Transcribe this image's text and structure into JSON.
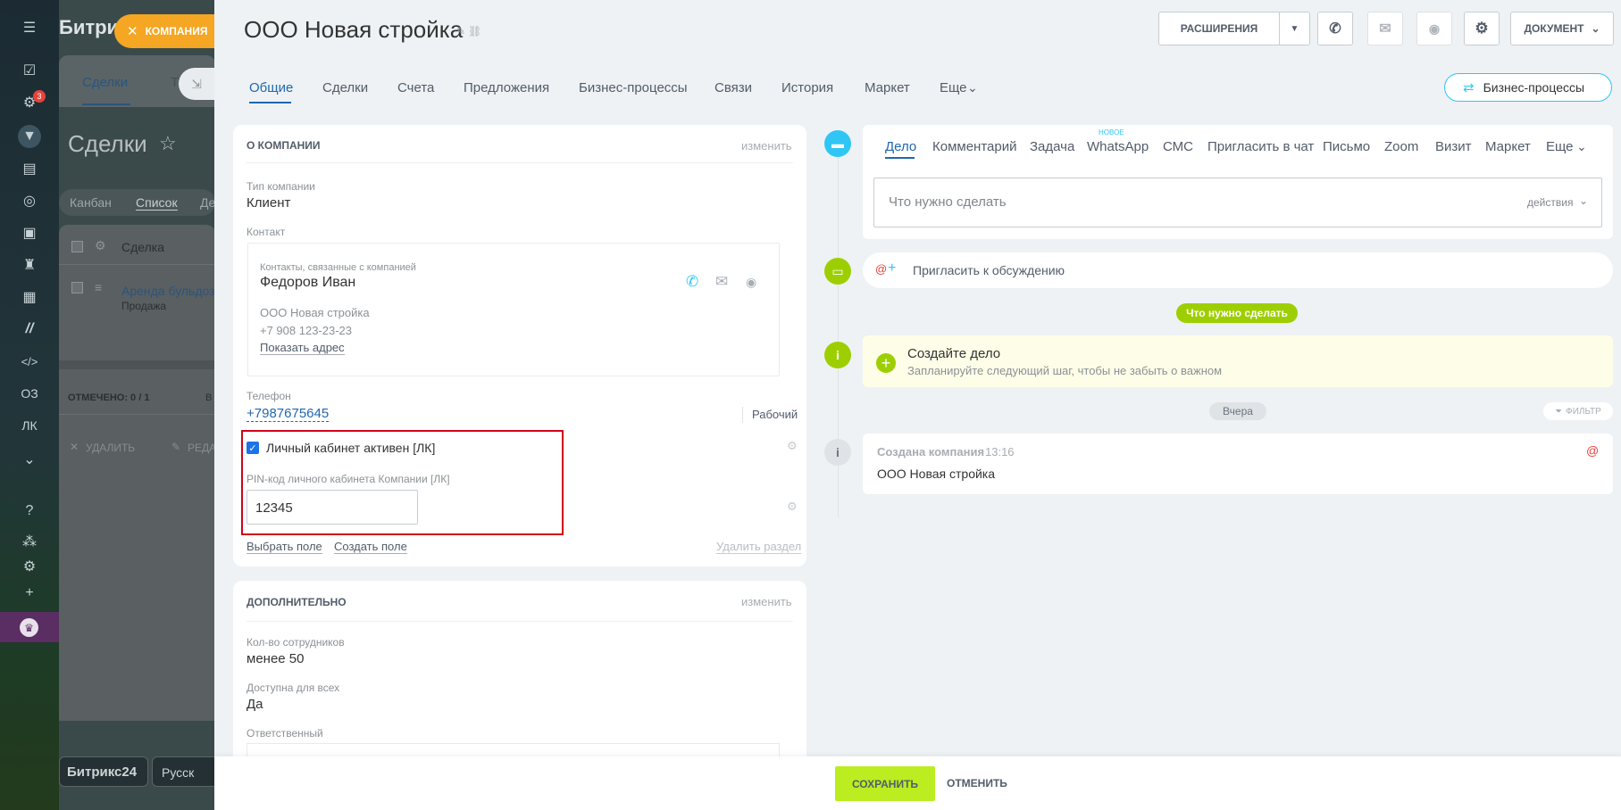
{
  "sidebar": {
    "badge_count": "3",
    "item_oz": "ОЗ",
    "item_lk": "ЛК"
  },
  "background": {
    "brand": "Битри",
    "company_chip": "КОМПАНИЯ",
    "tab_deals": "Сделки",
    "tab_t": "Т",
    "page_title": "Сделки",
    "view_kanban": "Канбан",
    "view_list": "Список",
    "view_de": "Де",
    "col_deal": "Сделка",
    "row_title": "Аренда бульдоз",
    "row_subtitle": "Продажа",
    "marked": "ОТМЕЧЕНО: 0 / 1",
    "marked_extra": "В",
    "delete": "УДАЛИТЬ",
    "edit": "РЕДА",
    "footer_brand": "Битрикс24",
    "footer_lang": "Русск"
  },
  "header": {
    "title": "ООО Новая стройка",
    "extensions": "РАСШИРЕНИЯ",
    "document": "ДОКУМЕНТ"
  },
  "tabs": [
    "Общие",
    "Сделки",
    "Счета",
    "Предложения",
    "Бизнес-процессы",
    "Связи",
    "История",
    "Маркет",
    "Еще"
  ],
  "bp_button": "Бизнес-процессы",
  "about": {
    "section_title": "О КОМПАНИИ",
    "edit": "изменить",
    "type_label": "Тип компании",
    "type_value": "Клиент",
    "contact_label": "Контакт",
    "contacts_caption": "Контакты, связанные с компанией",
    "contact_name": "Федоров Иван",
    "contact_company": "ООО Новая стройка",
    "contact_phone": "+7 908 123-23-23",
    "show_address": "Показать адрес",
    "phone_label": "Телефон",
    "phone_value": "+7987675645",
    "phone_type": "Рабочий",
    "cabinet_label": "Личный кабинет активен [ЛК]",
    "cabinet_checked": true,
    "pin_label": "PIN-код личного кабинета Компании [ЛК]",
    "pin_value": "12345",
    "select_field": "Выбрать поле",
    "create_field": "Создать поле",
    "delete_section": "Удалить раздел"
  },
  "extra": {
    "section_title": "ДОПОЛНИТЕЛЬНО",
    "edit": "изменить",
    "employees_label": "Кол-во сотрудников",
    "employees_value": "менее 50",
    "available_label": "Доступна для всех",
    "available_value": "Да",
    "responsible_label": "Ответственный"
  },
  "timeline": {
    "tabs": [
      "Дело",
      "Комментарий",
      "Задача",
      "WhatsApp",
      "СМС",
      "Пригласить в чат",
      "Письмо",
      "Zoom",
      "Визит",
      "Маркет",
      "Еще"
    ],
    "new_badge": "НОВОЕ",
    "todo_placeholder": "Что нужно сделать",
    "actions": "действия",
    "invite": "Пригласить к обсуждению",
    "todo_badge": "Что нужно сделать",
    "create_title": "Создайте дело",
    "create_sub": "Запланируйте следующий шаг, чтобы не забыть о важном",
    "yesterday": "Вчера",
    "filter": "ФИЛЬТР",
    "created_title": "Создана компания",
    "created_time": "13:16",
    "created_text": "ООО Новая стройка"
  },
  "footer": {
    "save": "СОХРАНИТЬ",
    "cancel": "ОТМЕНИТЬ"
  },
  "colors": {
    "accent": "#2067b0",
    "save": "#bbed21",
    "highlight": "#d0021b",
    "timeline_blue": "#2fc6f6",
    "timeline_green": "#9dcf00"
  }
}
